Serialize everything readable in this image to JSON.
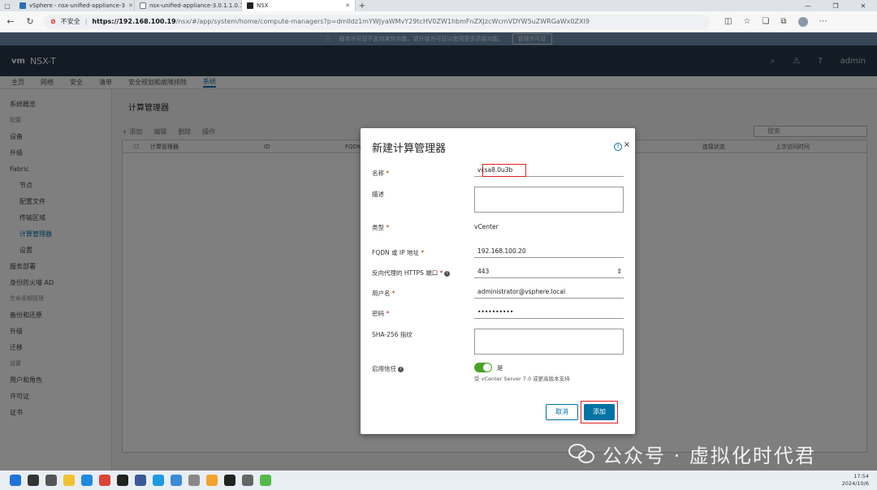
{
  "browser": {
    "tabs": [
      {
        "label": "vSphere - nsx-unified-appliance-3",
        "fav_color": "#2d6db5"
      },
      {
        "label": "nsx-unified-appliance-3.0.1.1.0.1",
        "fav_color": "#777777"
      },
      {
        "label": "NSX",
        "fav_color": "#222222"
      }
    ],
    "new_tab": "+",
    "url_warning": "不安全",
    "url_host": "https://192.168.100.19",
    "url_path": "/nsx/#/app/system/home/compute-managers?p=dmlldz1mYWJyaWMvY29tcHV0ZW1hbmFnZXJzcWcmVDYW5uZWRGaWx0ZXI9"
  },
  "app": {
    "banner_text": "版本许可证不支持某些功能，请升级许可证以使用更多高级功能。",
    "banner_button": "管理许可证",
    "logo": "vm",
    "product": "NSX-T",
    "user": "admin",
    "nav": [
      "主页",
      "网络",
      "安全",
      "清单",
      "安全规划和故障排除",
      "系统"
    ],
    "sidebar": [
      "系统概览",
      "配置",
      "设备",
      "升级",
      "Fabric",
      "节点",
      "配置文件",
      "传输区域",
      "计算管理器",
      "设置",
      "服务部署",
      "身份防火墙 AD",
      "生命周期管理",
      "备份和还原",
      "升级",
      "迁移",
      "设置",
      "用户和角色",
      "许可证",
      "证书"
    ],
    "page_title": "计算管理器",
    "toolbar": [
      "+ 添加",
      "编辑",
      "删除",
      "操作"
    ],
    "search_placeholder": "搜索",
    "columns": [
      "计算管理器",
      "ID",
      "FQDN",
      "连接状态",
      "上次访问时间"
    ]
  },
  "modal": {
    "title": "新建计算管理器",
    "help": "?",
    "close": "×",
    "fields": {
      "name_label": "名称",
      "name_value": "vcsa8.0u3b",
      "desc_label": "描述",
      "type_label": "类型",
      "type_value": "vCenter",
      "fqdn_label": "FQDN 或 IP 地址",
      "fqdn_value": "192.168.100.20",
      "port_label": "反向代理的 HTTPS 端口",
      "port_value": "443",
      "user_label": "用户名",
      "user_value": "administrator@vsphere.local",
      "pass_label": "密码",
      "pass_value": "••••••••••",
      "sha_label": "SHA-256 指纹",
      "trust_label": "启用信任",
      "trust_value": "是",
      "trust_note": "受 vCenter Server 7.0 或更高版本支持"
    },
    "cancel": "取消",
    "add": "添加"
  },
  "watermark": "公众号 · 虚拟化时代君",
  "taskbar": {
    "time": "17:54",
    "date": "2024/10/6",
    "icons": [
      "#1e74d8",
      "#333333",
      "#555555",
      "#f2c12e",
      "#1e8ae0",
      "#db4437",
      "#222222",
      "#3b5998",
      "#1e9be0",
      "#3c8ad8",
      "#888888",
      "#f2a22e",
      "#222222",
      "#666666",
      "#54b948"
    ]
  }
}
